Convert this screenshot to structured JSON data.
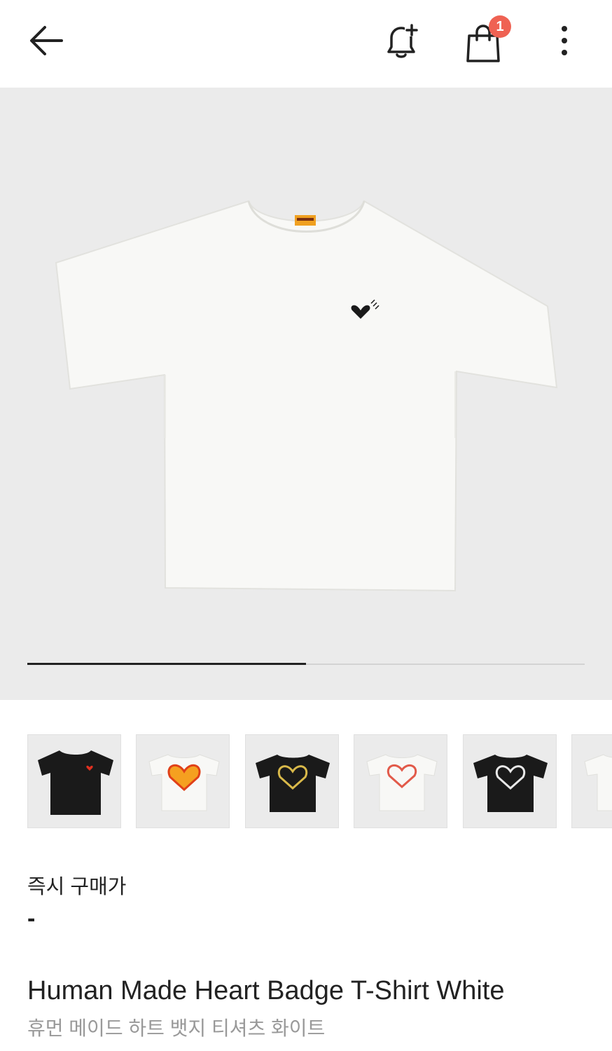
{
  "header": {
    "back_icon": "arrow-left-icon",
    "alert_icon": "bell-plus-icon",
    "cart_icon": "shopping-bag-icon",
    "cart_count": "1",
    "more_icon": "more-vertical-icon",
    "badge_color": "#ef6253"
  },
  "gallery": {
    "image_progress": 0.5,
    "main_image": "white t-shirt with black heart badge"
  },
  "thumbnails": [
    {
      "name": "black-shirt-red-heart"
    },
    {
      "name": "white-shirt-orange-heart-print"
    },
    {
      "name": "black-shirt-yellow-heart-print"
    },
    {
      "name": "white-shirt-red-heart-print"
    },
    {
      "name": "black-shirt-white-heart-print"
    },
    {
      "name": "white-shirt-partial"
    }
  ],
  "product": {
    "price_label": "즉시 구매가",
    "price_value": "-",
    "title_en": "Human Made Heart Badge T-Shirt White",
    "title_ko": "휴먼 메이드 하트 뱃지 티셔츠 화이트"
  }
}
